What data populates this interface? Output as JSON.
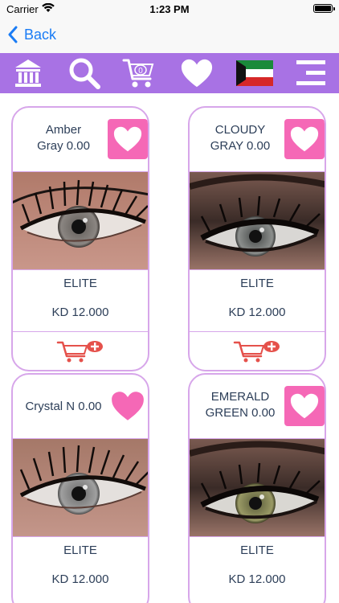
{
  "status_bar": {
    "carrier": "Carrier",
    "time": "1:23 PM"
  },
  "nav": {
    "back_label": "Back"
  },
  "toolbar": {
    "cart_count": "0",
    "icons": [
      "bank-icon",
      "search-icon",
      "cart-icon",
      "heart-icon",
      "kuwait-flag-icon",
      "menu-icon"
    ]
  },
  "colors": {
    "accent_purple": "#a872e4",
    "card_border": "#d7a6ea",
    "favorite_pink": "#f568b6",
    "cart_red": "#e5514b",
    "link_blue": "#1a7cf5",
    "text_navy": "#2c3e58"
  },
  "products": [
    {
      "name_line1": "Amber",
      "name_line2": "Gray 0.00",
      "brand": "ELITE",
      "price": "KD 12.000",
      "iris_color": "gray"
    },
    {
      "name_line1": "CLOUDY",
      "name_line2": "GRAY 0.00",
      "brand": "ELITE",
      "price": "KD 12.000",
      "iris_color": "gray"
    },
    {
      "name_line1": "Crystal N 0.00",
      "brand": "ELITE",
      "price": "KD 12.000",
      "iris_color": "gray"
    },
    {
      "name_line1": "EMERALD",
      "name_line2": "GREEN 0.00",
      "brand": "ELITE",
      "price": "KD 12.000",
      "iris_color": "green"
    }
  ]
}
